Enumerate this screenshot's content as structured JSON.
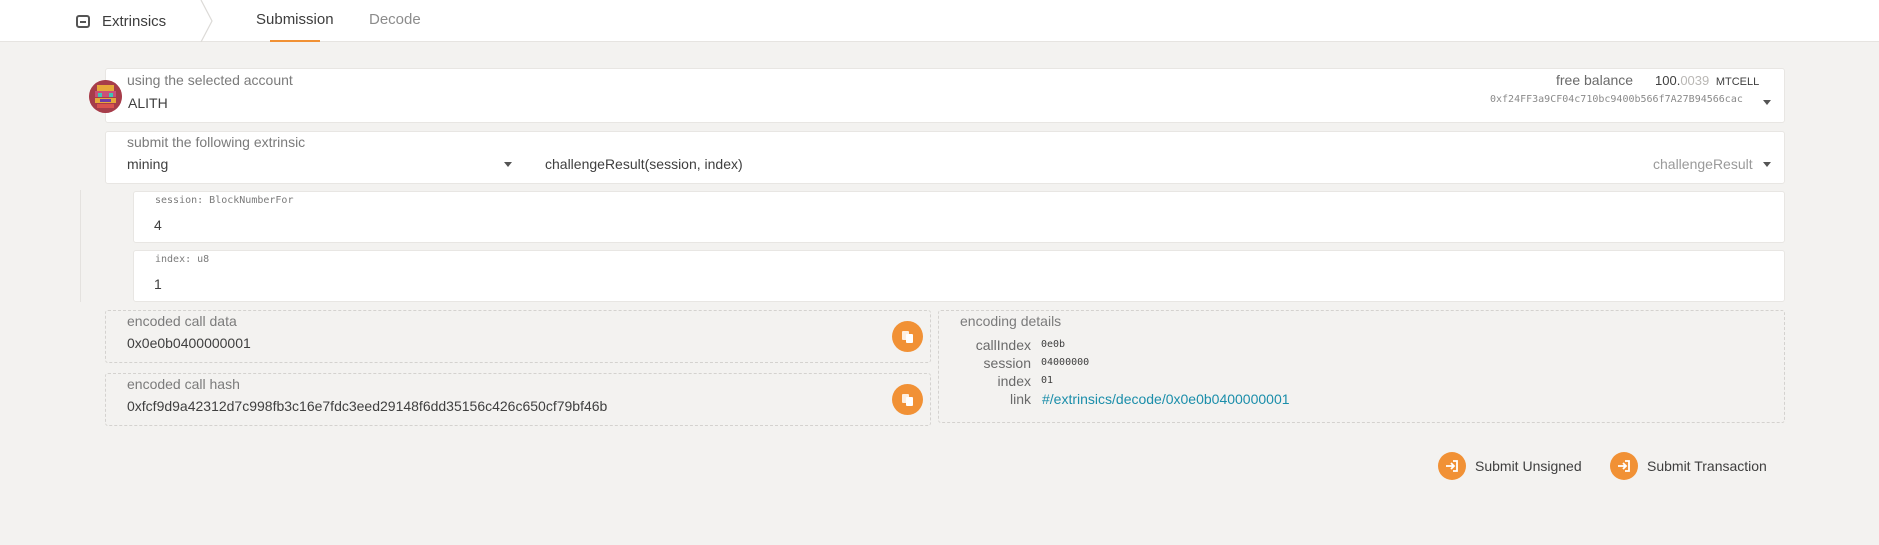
{
  "nav": {
    "brand_label": "Extrinsics",
    "tabs": [
      {
        "label": "Submission",
        "active": true
      },
      {
        "label": "Decode",
        "active": false
      }
    ]
  },
  "account": {
    "label": "using the selected account",
    "name": "ALITH",
    "free_balance_label": "free balance",
    "balance_int": "100.",
    "balance_frac": "0039",
    "balance_unit": "MTCELL",
    "address": "0xf24FF3a9CF04c710bc9400b566f7A27B94566cac"
  },
  "extrinsic": {
    "label": "submit the following extrinsic",
    "pallet": "mining",
    "call_signature": "challengeResult(session, index)",
    "call_name": "challengeResult"
  },
  "params": [
    {
      "label": "session: BlockNumberFor",
      "value": "4"
    },
    {
      "label": "index: u8",
      "value": "1"
    }
  ],
  "encoded": {
    "call_data_label": "encoded call data",
    "call_data": "0x0e0b0400000001",
    "call_hash_label": "encoded call hash",
    "call_hash": "0xfcf9d9a42312d7c998fb3c16e7fdc3eed29148f6dd35156c426c650cf79bf46b"
  },
  "details": {
    "title": "encoding details",
    "rows": [
      {
        "key": "callIndex",
        "value": "0e0b"
      },
      {
        "key": "session",
        "value": "04000000"
      },
      {
        "key": "index",
        "value": "01"
      },
      {
        "key": "link",
        "value": "#/extrinsics/decode/0x0e0b0400000001"
      }
    ]
  },
  "actions": {
    "submit_unsigned": "Submit Unsigned",
    "submit_transaction": "Submit Transaction"
  },
  "colors": {
    "accent": "#f19135",
    "link": "#1b8eaa"
  },
  "icons": [
    "extrinsics-icon",
    "chevron-down-icon",
    "copy-icon",
    "sign-in-icon",
    "identicon"
  ]
}
